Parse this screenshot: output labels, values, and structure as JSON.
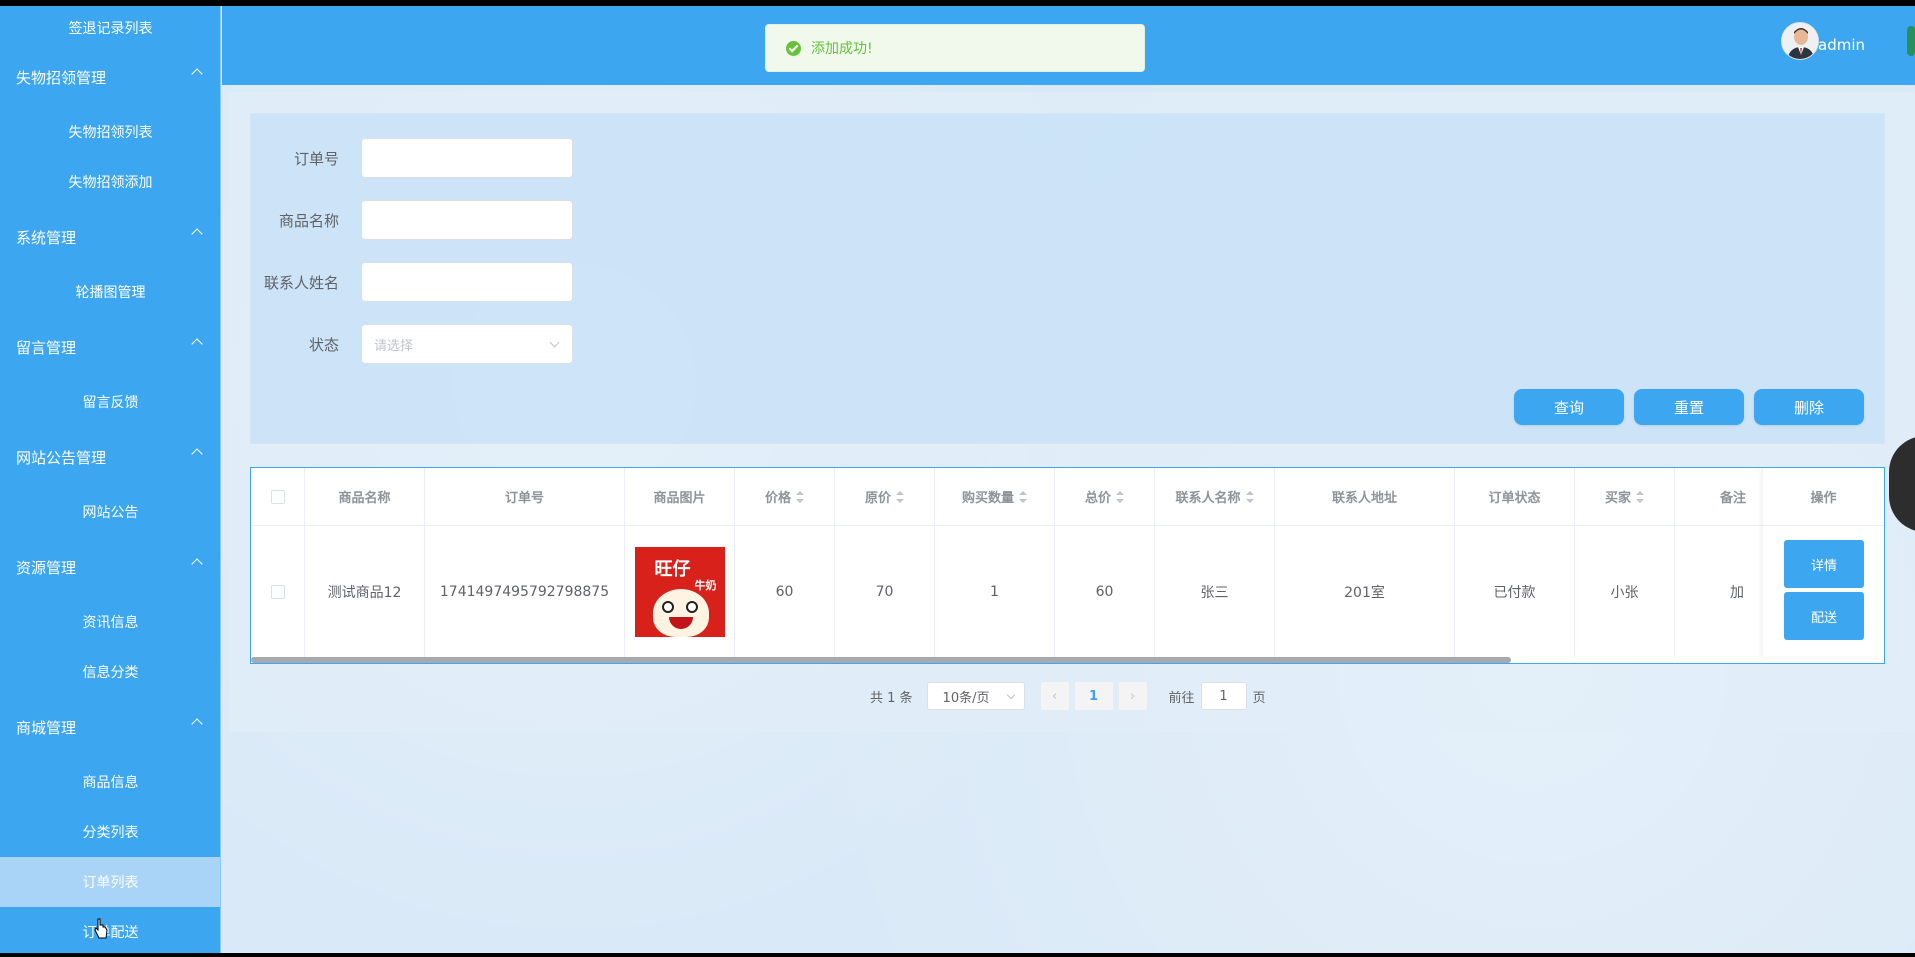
{
  "toast": {
    "text": "添加成功!"
  },
  "header": {
    "username": "admin"
  },
  "sidebar": {
    "items": [
      {
        "type": "item",
        "label": "签退记录列表"
      },
      {
        "type": "group",
        "label": "失物招领管理"
      },
      {
        "type": "item",
        "label": "失物招领列表"
      },
      {
        "type": "item",
        "label": "失物招领添加"
      },
      {
        "type": "group",
        "label": "系统管理"
      },
      {
        "type": "item",
        "label": "轮播图管理"
      },
      {
        "type": "group",
        "label": "留言管理"
      },
      {
        "type": "item",
        "label": "留言反馈"
      },
      {
        "type": "group",
        "label": "网站公告管理"
      },
      {
        "type": "item",
        "label": "网站公告"
      },
      {
        "type": "group",
        "label": "资源管理"
      },
      {
        "type": "item",
        "label": "资讯信息"
      },
      {
        "type": "item",
        "label": "信息分类"
      },
      {
        "type": "group",
        "label": "商城管理"
      },
      {
        "type": "item",
        "label": "商品信息"
      },
      {
        "type": "item",
        "label": "分类列表"
      },
      {
        "type": "item",
        "label": "订单列表",
        "active": true
      },
      {
        "type": "item",
        "label": "订单配送"
      }
    ]
  },
  "search": {
    "order_no_label": "订单号",
    "goods_name_label": "商品名称",
    "contact_name_label": "联系人姓名",
    "status_label": "状态",
    "status_placeholder": "请选择",
    "query_button": "查询",
    "reset_button": "重置",
    "delete_button": "删除"
  },
  "table": {
    "headers": [
      "商品名称",
      "订单号",
      "商品图片",
      "价格",
      "原价",
      "购买数量",
      "总价",
      "联系人名称",
      "联系人地址",
      "订单状态",
      "买家",
      "备注"
    ],
    "ops_header": "操作",
    "rows": [
      {
        "goods_name": "测试商品12",
        "order_no": "1741497495792798875",
        "img_text": "旺仔",
        "img_text2": "牛奶",
        "price": "60",
        "original_price": "70",
        "quantity": "1",
        "total": "60",
        "contact_name": "张三",
        "contact_address": "201室",
        "status": "已付款",
        "buyer": "小张",
        "remark": "加",
        "detail_button": "详情",
        "deliver_button": "配送"
      }
    ]
  },
  "pager": {
    "total_text": "共 1 条",
    "page_size": "10条/页",
    "current_page": "1",
    "goto_label": "前往",
    "goto_value": "1",
    "page_suffix": "页"
  }
}
